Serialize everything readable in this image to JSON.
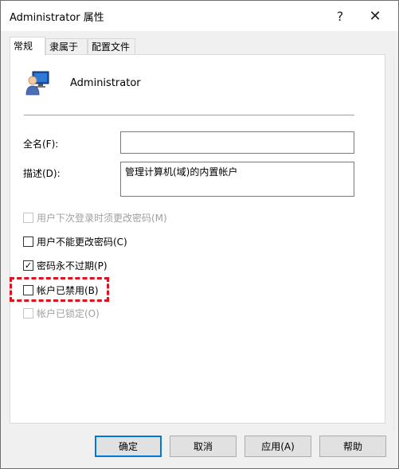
{
  "window": {
    "title": "Administrator 属性",
    "help_glyph": "?",
    "close_glyph": "✕"
  },
  "tabs": [
    {
      "label": "常规",
      "active": true
    },
    {
      "label": "隶属于",
      "active": false
    },
    {
      "label": "配置文件",
      "active": false
    }
  ],
  "general": {
    "username": "Administrator",
    "fullname_label": "全名(F):",
    "fullname_value": "",
    "description_label": "描述(D):",
    "description_value": "管理计算机(域)的内置帐户",
    "checkboxes": [
      {
        "label": "用户下次登录时须更改密码(M)",
        "checked": false,
        "disabled": true
      },
      {
        "label": "用户不能更改密码(C)",
        "checked": false,
        "disabled": false
      },
      {
        "label": "密码永不过期(P)",
        "checked": true,
        "disabled": false
      },
      {
        "label": "帐户已禁用(B)",
        "checked": false,
        "disabled": false
      },
      {
        "label": "帐户已锁定(O)",
        "checked": false,
        "disabled": true
      }
    ],
    "check_glyph": "✓"
  },
  "buttons": {
    "ok": "确定",
    "cancel": "取消",
    "apply": "应用(A)",
    "help": "帮助"
  },
  "colors": {
    "highlight": "#e0101e",
    "default_button_border": "#0078d7"
  }
}
